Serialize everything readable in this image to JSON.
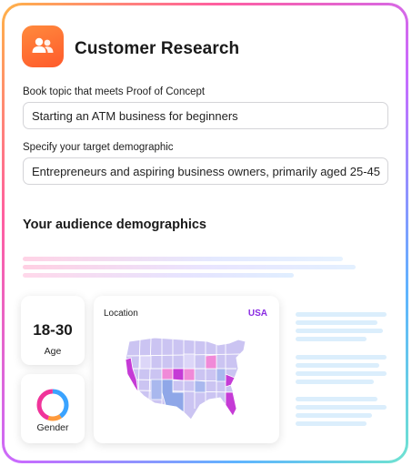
{
  "header": {
    "title": "Customer Research",
    "icon": "people-icon"
  },
  "form": {
    "topic_label": "Book topic that meets Proof of Concept",
    "topic_value": "Starting an ATM business for beginners",
    "demographic_label": "Specify your target demographic",
    "demographic_value": "Entrepreneurs and aspiring business owners, primarily aged 25-45"
  },
  "audience": {
    "section_title": "Your audience demographics",
    "age": {
      "value": "18-30",
      "label": "Age"
    },
    "gender": {
      "label": "Gender"
    },
    "location": {
      "label": "Location",
      "country": "USA"
    }
  },
  "colors": {
    "accent": "#8a2be2",
    "icon_orange": "#ff6a2e",
    "map_base": "#c9c2f0",
    "map_highlight": "#c53bd6",
    "map_pink": "#f08ad8",
    "map_blue": "#8fa7e8"
  }
}
